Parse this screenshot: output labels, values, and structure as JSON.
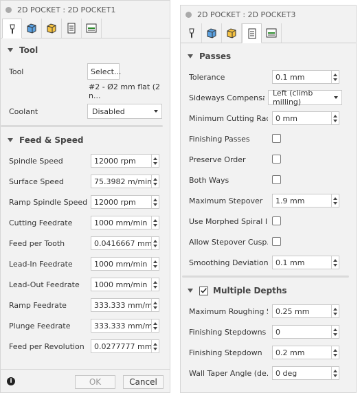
{
  "left": {
    "title": "2D POCKET : 2D POCKET1",
    "tool_section": "Tool",
    "tool_label": "Tool",
    "tool_button": "Select...",
    "tool_desc": "#2 - Ø2 mm flat (2 n...",
    "coolant_label": "Coolant",
    "coolant_value": "Disabled",
    "feed_section": "Feed & Speed",
    "rows": [
      {
        "label": "Spindle Speed",
        "value": "12000 rpm"
      },
      {
        "label": "Surface Speed",
        "value": "75.3982 m/min"
      },
      {
        "label": "Ramp Spindle Speed",
        "value": "12000 rpm"
      },
      {
        "label": "Cutting Feedrate",
        "value": "1000 mm/min"
      },
      {
        "label": "Feed per Tooth",
        "value": "0.0416667 mm"
      },
      {
        "label": "Lead-In Feedrate",
        "value": "1000 mm/min"
      },
      {
        "label": "Lead-Out Feedrate",
        "value": "1000 mm/min"
      },
      {
        "label": "Ramp Feedrate",
        "value": "333.333 mm/min"
      },
      {
        "label": "Plunge Feedrate",
        "value": "333.333 mm/min"
      },
      {
        "label": "Feed per Revolution",
        "value": "0.0277777 mm"
      }
    ],
    "ok": "OK",
    "cancel": "Cancel"
  },
  "right": {
    "title": "2D POCKET : 2D POCKET3",
    "passes_section": "Passes",
    "tolerance_label": "Tolerance",
    "tolerance_value": "0.1 mm",
    "sideways_label": "Sideways Compensa...",
    "sideways_value": "Left (climb milling)",
    "min_cut_label": "Minimum Cutting Rad...",
    "min_cut_value": "0 mm",
    "finishing_passes_label": "Finishing Passes",
    "preserve_order_label": "Preserve Order",
    "both_ways_label": "Both Ways",
    "max_stepover_label": "Maximum Stepover",
    "max_stepover_value": "1.9 mm",
    "morphed_label": "Use Morphed Spiral I...",
    "allow_stepover_label": "Allow Stepover Cusp...",
    "smoothing_label": "Smoothing Deviation",
    "smoothing_value": "0.1 mm",
    "depths_section": "Multiple Depths",
    "max_rough_label": "Maximum Roughing S...",
    "max_rough_value": "0.25 mm",
    "fin_stepdowns_label": "Finishing Stepdowns",
    "fin_stepdowns_value": "0",
    "fin_stepdown_label": "Finishing Stepdown",
    "fin_stepdown_value": "0.2 mm",
    "wall_taper_label": "Wall Taper Angle (de...",
    "wall_taper_value": "0 deg"
  }
}
